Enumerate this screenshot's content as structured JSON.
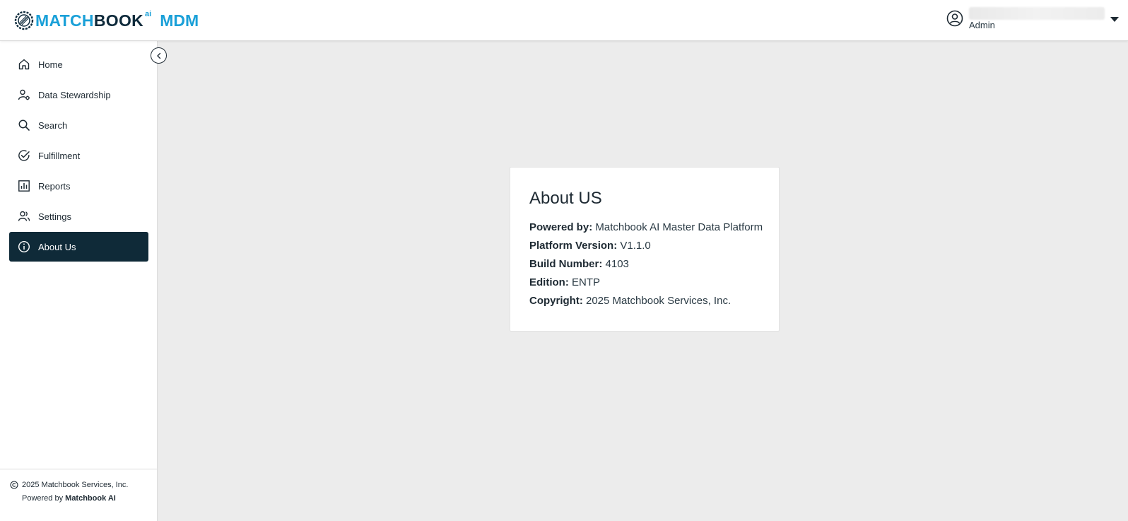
{
  "header": {
    "logo": {
      "word_a": "MATCH",
      "word_b": "BOOK",
      "sup": "ai",
      "product": "MDM"
    },
    "user": {
      "role": "Admin"
    }
  },
  "sidebar": {
    "items": [
      {
        "label": "Home",
        "icon": "home-icon",
        "active": false
      },
      {
        "label": "Data Stewardship",
        "icon": "data-stewardship-icon",
        "active": false
      },
      {
        "label": "Search",
        "icon": "search-icon",
        "active": false
      },
      {
        "label": "Fulfillment",
        "icon": "check-circle-icon",
        "active": false
      },
      {
        "label": "Reports",
        "icon": "bar-chart-icon",
        "active": false
      },
      {
        "label": "Settings",
        "icon": "users-icon",
        "active": false
      },
      {
        "label": "About Us",
        "icon": "info-icon",
        "active": true
      }
    ],
    "footer": {
      "copyright": "2025 Matchbook Services, Inc.",
      "powered_prefix": "Powered by",
      "powered_brand": "Matchbook AI"
    }
  },
  "about": {
    "title": "About US",
    "rows": [
      {
        "key": "Powered by:",
        "value": "Matchbook AI Master Data Platform"
      },
      {
        "key": "Platform Version:",
        "value": "V1.1.0"
      },
      {
        "key": "Build Number:",
        "value": "4103"
      },
      {
        "key": "Edition:",
        "value": "ENTP"
      },
      {
        "key": "Copyright:",
        "value": "2025 Matchbook Services, Inc."
      }
    ]
  },
  "colors": {
    "brand_blue": "#1aa0d8",
    "brand_navy": "#0e2a3b",
    "active_nav_bg": "#0f2a38",
    "page_bg": "#ececec"
  }
}
